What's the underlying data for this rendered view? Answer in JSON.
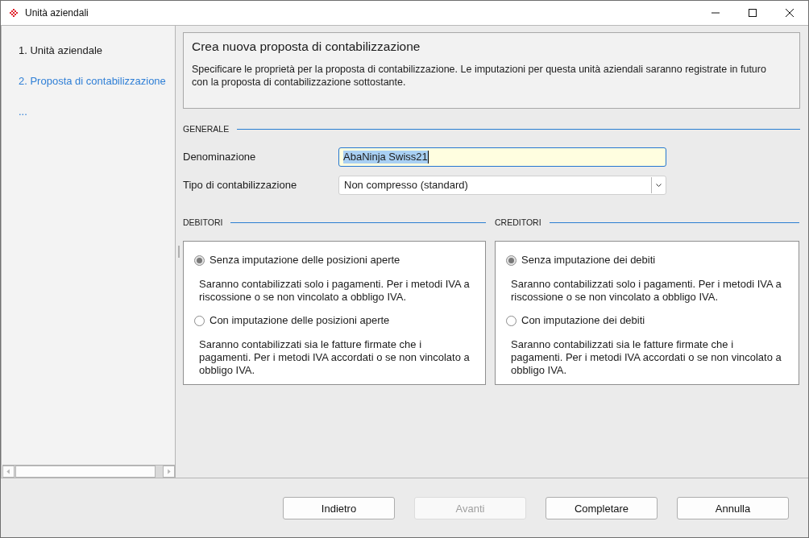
{
  "window": {
    "title": "Unità aziendali"
  },
  "sidebar": {
    "steps": [
      {
        "label": "1. Unità aziendale",
        "selected": false
      },
      {
        "label": "2. Proposta di contabilizzazione",
        "selected": true
      }
    ],
    "more": "..."
  },
  "header": {
    "title": "Crea nuova proposta di contabilizzazione",
    "description": "Specificare le proprietà per la proposta di contabilizzazione. Le imputazioni per questa unità aziendali saranno registrate in futuro con la proposta di contabilizzazione sottostante."
  },
  "general": {
    "heading": "GENERALE",
    "fields": [
      {
        "kind": "text",
        "label": "Denominazione",
        "value": "AbaNinja Swiss21",
        "focused": true
      },
      {
        "kind": "select",
        "label": "Tipo di contabilizzazione",
        "value": "Non compresso (standard)"
      }
    ]
  },
  "groups": [
    {
      "heading": "DEBITORI",
      "options": [
        {
          "label": "Senza imputazione delle posizioni aperte",
          "selected": true,
          "description": "Saranno contabilizzati solo i pagamenti. Per i metodi IVA a riscossione o se non vincolato a obbligo IVA."
        },
        {
          "label": "Con imputazione delle posizioni aperte",
          "selected": false,
          "description": "Saranno contabilizzati sia le fatture firmate che i pagamenti. Per i metodi IVA accordati o se non vincolato a obbligo IVA."
        }
      ]
    },
    {
      "heading": "CREDITORI",
      "options": [
        {
          "label": "Senza imputazione dei debiti",
          "selected": true,
          "description": "Saranno contabilizzati solo i pagamenti. Per i metodi IVA a riscossione o se non vincolato a obbligo IVA."
        },
        {
          "label": "Con imputazione dei debiti",
          "selected": false,
          "description": "Saranno contabilizzati sia le fatture firmate che i pagamenti. Per i metodi IVA accordati o se non vincolato a obbligo IVA."
        }
      ]
    }
  ],
  "buttons": [
    {
      "label": "Indietro",
      "disabled": false
    },
    {
      "label": "Avanti",
      "disabled": true
    },
    {
      "label": "Completare",
      "disabled": false
    },
    {
      "label": "Annulla",
      "disabled": false
    }
  ]
}
